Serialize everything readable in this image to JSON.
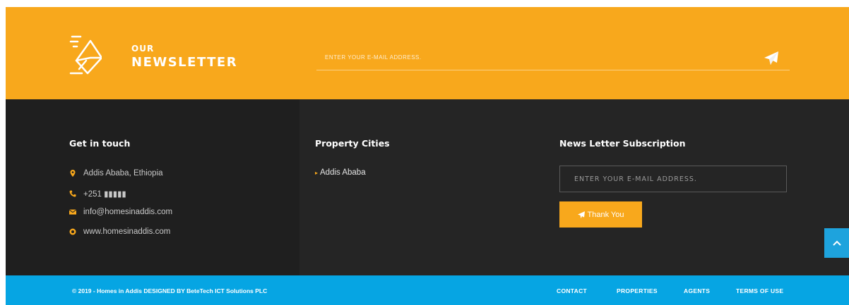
{
  "newsletter": {
    "title_small": "OUR",
    "title_large": "NEWSLETTER",
    "input_placeholder": "ENTER YOUR E-MAIL ADDRESS.",
    "icon": "envelope-speed-icon",
    "send_icon": "paper-plane-icon"
  },
  "get_in_touch": {
    "heading": "Get in touch",
    "items": [
      {
        "icon": "map-pin-icon",
        "text": "Addis Ababa, Ethiopia"
      },
      {
        "icon": "phone-icon",
        "text": "+251 ⁠▮▮▮▮▮"
      },
      {
        "icon": "envelope-icon",
        "text": "info@homesinaddis.com"
      },
      {
        "icon": "globe-icon",
        "text": "www.homesinaddis.com"
      }
    ]
  },
  "property_cities": {
    "heading": "Property Cities",
    "items": [
      "Addis Ababa"
    ]
  },
  "subscription": {
    "heading": "News Letter Subscription",
    "input_placeholder": "ENTER YOUR E-MAIL ADDRESS.",
    "button_label": "Thank You"
  },
  "scroll_top_icon": "chevron-up-icon",
  "footer": {
    "copyright": "© 2019 - Homes in Addis DESIGNED BY BeteTech ICT Solutions PLC",
    "links": [
      "CONTACT",
      "PROPERTIES",
      "AGENTS",
      "TERMS OF USE"
    ]
  },
  "colors": {
    "accent": "#f8a81c",
    "dark": "#1f1f1f",
    "footer_blue": "#06a5e3"
  }
}
